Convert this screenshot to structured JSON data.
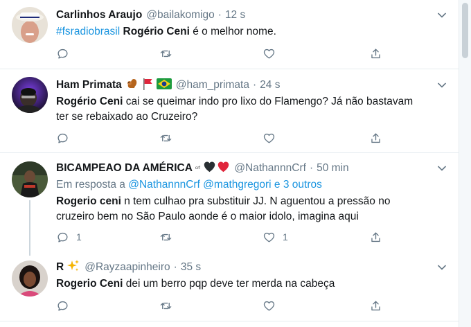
{
  "tweets": [
    {
      "display_name": "Carlinhos Araujo",
      "handle": "@bailakomigo",
      "separator": "·",
      "time": "12 s",
      "text_hashtag": "#fsradiobrasil",
      "text_bold": "Rogério Ceni",
      "text_rest": " é o melhor nome.",
      "counts": {
        "reply": "",
        "retweet": "",
        "like": ""
      }
    },
    {
      "display_name": "Ham Primata",
      "name_emojis": [
        "squirrel-emoji",
        "red-flag-emoji",
        "brazil-flag-emoji"
      ],
      "handle": "@ham_primata",
      "separator": "·",
      "time": "24 s",
      "text_bold": "Rogério Ceni",
      "text_rest_line1": " cai se queimar indo pro lixo do Flamengo? Já não bastavam",
      "text_rest_line2": "ter se rebaixado ao Cruzeiro?",
      "counts": {
        "reply": "",
        "retweet": "",
        "like": ""
      }
    },
    {
      "display_name": "BICAMPEAO DA AMÉRICA",
      "name_suffix": "ᶜʳᶠ",
      "name_emojis": [
        "black-heart-emoji",
        "red-heart-emoji"
      ],
      "handle": "@NathannnCrf",
      "separator": "·",
      "time": "50 min",
      "reply_prefix": "Em resposta a",
      "reply_mentions": "@NathannnCrf @mathgregori e 3 outros",
      "text_bold": "Rogerio ceni",
      "text_rest_line1": " n tem culhao pra substituir JJ. N aguentou a pressão no",
      "text_rest_line2": "cruzeiro bem no São Paulo aonde é o maior idolo, imagina aqui",
      "counts": {
        "reply": "1",
        "retweet": "",
        "like": "1"
      }
    },
    {
      "display_name": "R",
      "name_emojis": [
        "sparkles-emoji"
      ],
      "handle": "@Rayzaapinheiro",
      "separator": "·",
      "time": "35 s",
      "text_bold": "Rogerio Ceni",
      "text_rest": " dei um berro pqp deve ter merda na cabeça",
      "counts": {
        "reply": "",
        "retweet": "",
        "like": ""
      }
    }
  ],
  "colors": {
    "link": "#1b95e0",
    "secondary_text": "#657786",
    "divider": "#e6ecf0",
    "icon": "#657786"
  }
}
